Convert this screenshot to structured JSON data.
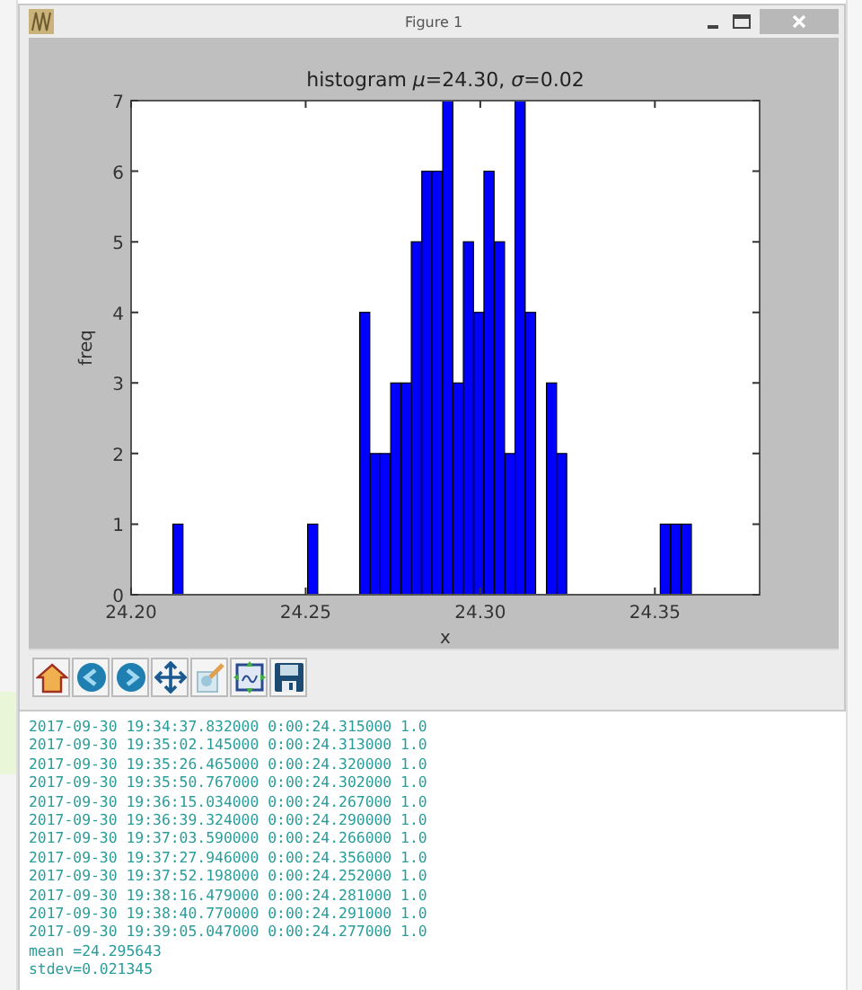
{
  "window": {
    "title": "Figure 1"
  },
  "figure": {
    "chart_data": {
      "type": "bar",
      "title": "histogram *μ*=24.30, *σ*=0.02",
      "xlabel": "x",
      "ylabel": "freq",
      "x": [
        24.2134,
        24.252,
        24.2669,
        24.2699,
        24.2728,
        24.2758,
        24.2788,
        24.2817,
        24.2847,
        24.2877,
        24.2907,
        24.2936,
        24.2966,
        24.2996,
        24.3025,
        24.3055,
        24.3085,
        24.3114,
        24.3144,
        24.3204,
        24.3233,
        24.353,
        24.356,
        24.359
      ],
      "series": [
        {
          "color": "#0000ff",
          "values": [
            1,
            1,
            4,
            2,
            2,
            3,
            3,
            5,
            6,
            6,
            7,
            3,
            5,
            4,
            6,
            5,
            2,
            7,
            4,
            3,
            2,
            1,
            1,
            1
          ]
        }
      ],
      "xlim": [
        24.2,
        24.38
      ],
      "ylim": [
        0,
        7
      ],
      "xticks": [
        {
          "value": 24.2,
          "label": "24.20"
        },
        {
          "value": 24.25,
          "label": "24.25"
        },
        {
          "value": 24.3,
          "label": "24.30"
        },
        {
          "value": 24.35,
          "label": "24.35"
        }
      ],
      "yticks": [
        0,
        1,
        2,
        3,
        4,
        5,
        6,
        7
      ]
    }
  },
  "toolbar": [
    {
      "kind": "home"
    },
    {
      "kind": "back"
    },
    {
      "kind": "forward"
    },
    {
      "kind": "pan"
    },
    {
      "kind": "edit"
    },
    {
      "kind": "subplots"
    },
    {
      "kind": "save"
    }
  ],
  "console": {
    "lines": [
      "2017-09-30 19:34:37.832000 0:00:24.315000 1.0",
      "2017-09-30 19:35:02.145000 0:00:24.313000 1.0",
      "2017-09-30 19:35:26.465000 0:00:24.320000 1.0",
      "2017-09-30 19:35:50.767000 0:00:24.302000 1.0",
      "2017-09-30 19:36:15.034000 0:00:24.267000 1.0",
      "2017-09-30 19:36:39.324000 0:00:24.290000 1.0",
      "2017-09-30 19:37:03.590000 0:00:24.266000 1.0",
      "2017-09-30 19:37:27.946000 0:00:24.356000 1.0",
      "2017-09-30 19:37:52.198000 0:00:24.252000 1.0",
      "2017-09-30 19:38:16.479000 0:00:24.281000 1.0",
      "2017-09-30 19:38:40.770000 0:00:24.291000 1.0",
      "2017-09-30 19:39:05.047000 0:00:24.277000 1.0",
      "mean =24.295643",
      "stdev=0.021345"
    ]
  }
}
